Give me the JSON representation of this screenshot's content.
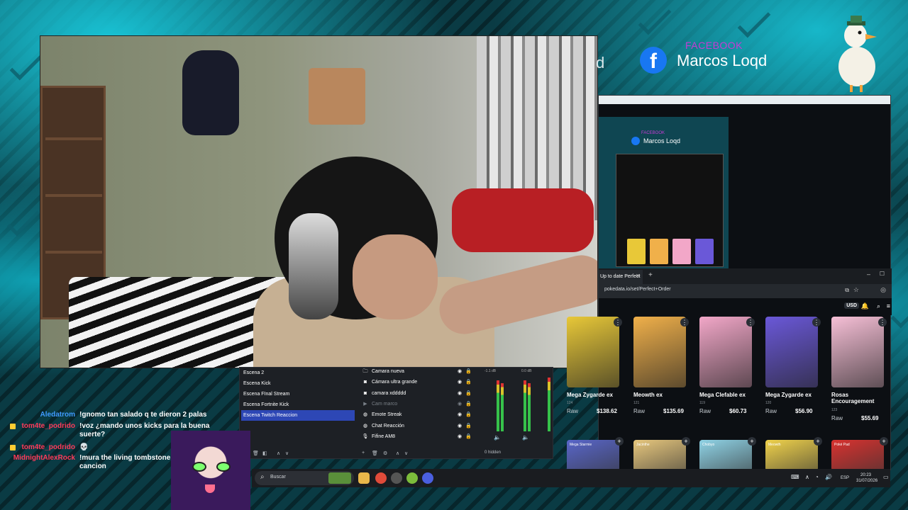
{
  "facebook": {
    "label": "FACEBOOK",
    "icon": "facebook-icon",
    "name": "Marcos Loqd",
    "ghost_letter": "d"
  },
  "nested_stream": {
    "label": "FACEBOOK",
    "name": "Marcos Loqd"
  },
  "browser": {
    "tab_title": "Up to date Perfect",
    "url": "pokedata.io/set/Perfect+Order",
    "currency": "USD"
  },
  "cards_row1": [
    {
      "name": "Mega Zygarde ex",
      "num": "124",
      "grade": "Raw",
      "price": "$138.62",
      "color": "#e8c838"
    },
    {
      "name": "Meowth ex",
      "num": "121",
      "grade": "Raw",
      "price": "$135.69",
      "color": "#f0b04a"
    },
    {
      "name": "Mega Clefable ex",
      "num": "119",
      "grade": "Raw",
      "price": "$60.73",
      "color": "#f2a7c8"
    },
    {
      "name": "Mega Zygarde ex",
      "num": "120",
      "grade": "Raw",
      "price": "$56.90",
      "color": "#6a58d8"
    },
    {
      "name": "Rosas Encouragement",
      "num": "123",
      "grade": "Raw",
      "price": "$55.69",
      "color": "#f6bfd6"
    }
  ],
  "cards_row2": [
    {
      "name": "Mega Starmie",
      "color": "#5966c9"
    },
    {
      "name": "Jacinthe",
      "color": "#e7c77d"
    },
    {
      "name": "Chobyo",
      "color": "#8fd3e6"
    },
    {
      "name": "Meowth",
      "color": "#f0d24b"
    },
    {
      "name": "Poké Pad",
      "color": "#d8322f"
    }
  ],
  "obs": {
    "scenes": [
      {
        "label": "Escena 2",
        "active": false
      },
      {
        "label": "Escena Kick",
        "active": false
      },
      {
        "label": "Escena FInal Stream",
        "active": false
      },
      {
        "label": "Escena Fortnite Kick",
        "active": false
      },
      {
        "label": "Escena Twitch Reaccion",
        "active": true
      }
    ],
    "sources": [
      {
        "label": "Camara nueva",
        "icon": "folder-icon",
        "dim": false
      },
      {
        "label": "Cámara ultra grande",
        "icon": "camera-icon",
        "dim": false
      },
      {
        "label": "camara xddddd",
        "icon": "camera-icon",
        "dim": false
      },
      {
        "label": "Cam marco",
        "icon": "play-icon",
        "dim": true
      },
      {
        "label": "Emote Streak",
        "icon": "globe-icon",
        "dim": false
      },
      {
        "label": "Chat Reacción",
        "icon": "globe-icon",
        "dim": false
      },
      {
        "label": "Fifine AM8",
        "icon": "mic-icon",
        "dim": false
      }
    ],
    "audio_db_1": "-1.1 dB",
    "audio_db_2": "0.0 dB",
    "hidden_label": "0 hidden"
  },
  "taskbar": {
    "search_placeholder": "Buscar",
    "lang": "ESP",
    "time": "20:23",
    "date": "31/07/2026"
  },
  "chat": [
    {
      "user": "Aledatrom",
      "color": "#3f9bff",
      "message": "!gnomo tan salado q te dieron 2 palas",
      "badge": false
    },
    {
      "user": "tom4te_podrido",
      "color": "#ff3b5a",
      "message": "!voz ¿mando unos kicks para la buena suerte?",
      "badge": true
    },
    {
      "user": "tom4te_podrido",
      "color": "#ff3b5a",
      "message": "💀",
      "badge": true
    },
    {
      "user": "MidnightAlexRock",
      "color": "#ff3b5a",
      "message": "!mura the living tombstone ta fina esa cancion",
      "badge": false
    }
  ],
  "colors": {
    "accent_teal": "#19c4d6",
    "obs_active": "#2d47b5",
    "facebook_blue": "#1877f2"
  }
}
